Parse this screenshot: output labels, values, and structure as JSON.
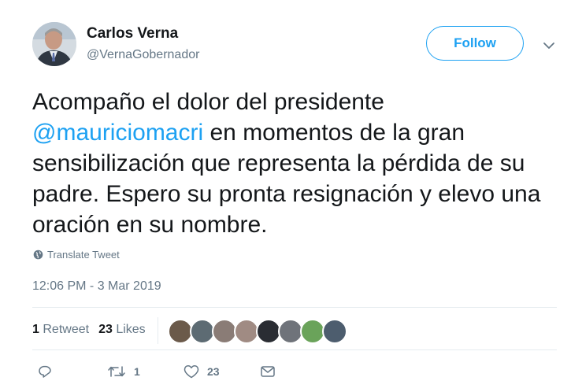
{
  "author": {
    "name": "Carlos Verna",
    "handle": "@VernaGobernador"
  },
  "follow_label": "Follow",
  "tweet": {
    "part1": "Acompaño el dolor del presidente ",
    "mention": "@mauriciomacri",
    "part2": " en momentos de la gran sensibilización que representa la pérdida de su padre. Espero su pronta resignación y elevo una oración en su nombre."
  },
  "translate_label": "Translate Tweet",
  "timestamp": "12:06 PM - 3 Mar 2019",
  "stats": {
    "retweets_count": "1",
    "retweets_label": "Retweet",
    "likes_count": "23",
    "likes_label": "Likes"
  },
  "actions": {
    "retweet_count": "1",
    "like_count": "23"
  },
  "colors": {
    "accent": "#1da1f2",
    "secondary_text": "#657786",
    "divider": "#e6ecf0"
  },
  "icons": [
    "chevron-down-icon",
    "globe-icon",
    "reply-icon",
    "retweet-icon",
    "heart-icon",
    "message-icon"
  ]
}
